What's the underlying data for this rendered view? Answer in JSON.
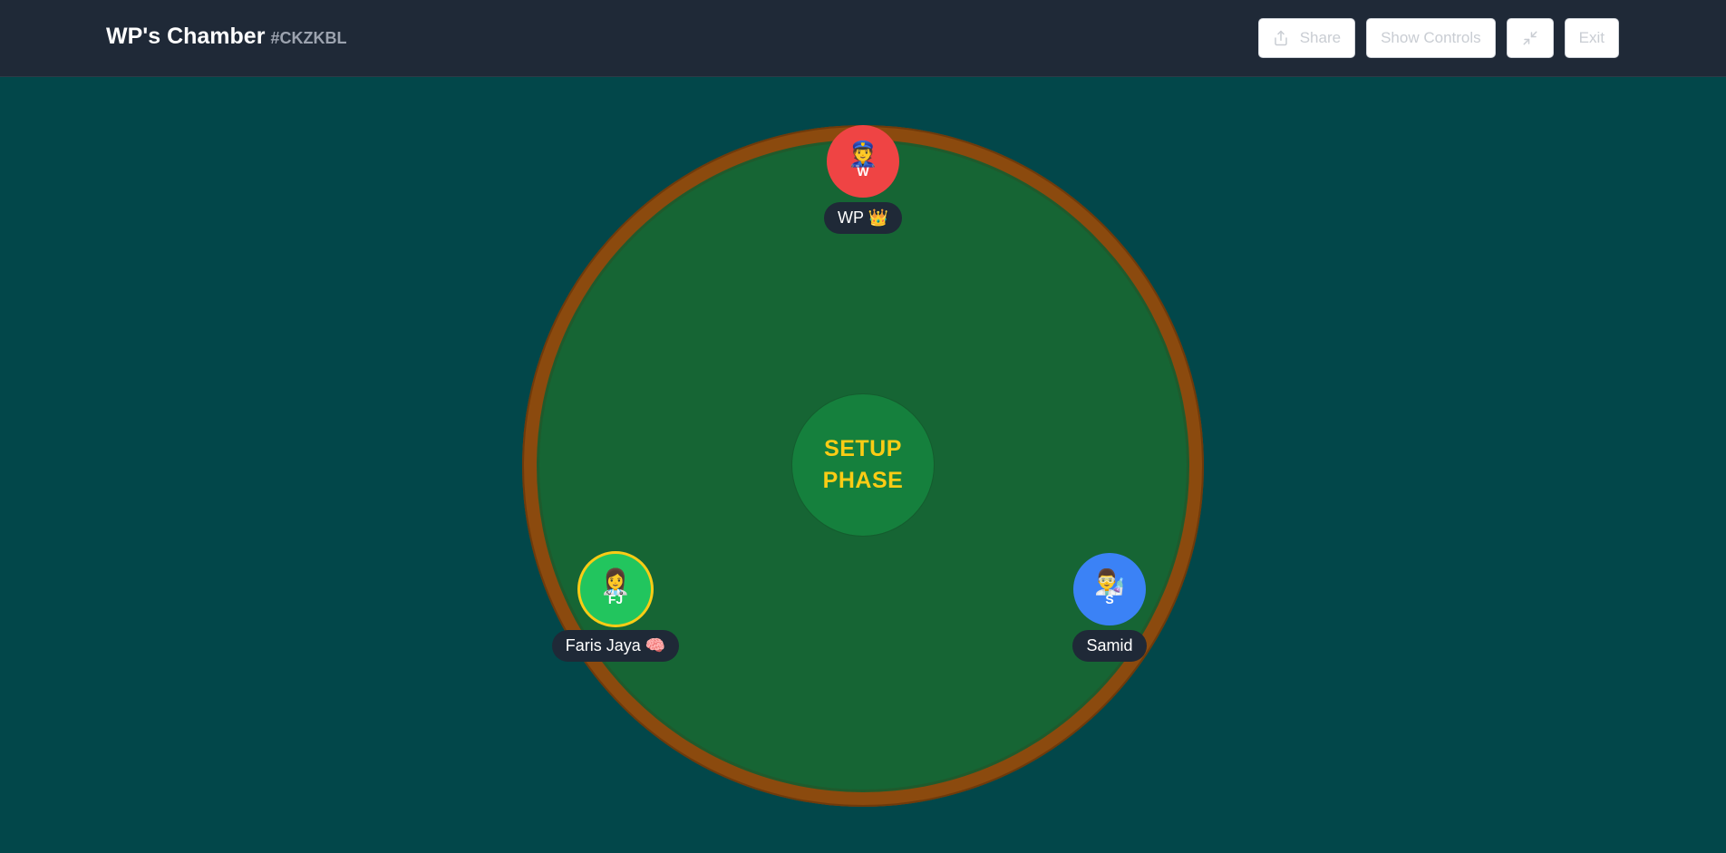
{
  "header": {
    "room_name": "WP's Chamber",
    "room_code": "#CKZKBL"
  },
  "controls": {
    "share_label": "Share",
    "show_controls_label": "Show Controls",
    "exit_label": "Exit",
    "share_icon": "share-icon",
    "minimize_icon": "minimize-icon"
  },
  "table": {
    "phase_line1": "SETUP",
    "phase_line2": "PHASE"
  },
  "players": [
    {
      "name": "WP 👑",
      "initials": "W",
      "emoji": "👮",
      "color": "#ef4444"
    },
    {
      "name": "Faris Jaya 🧠",
      "initials": "FJ",
      "emoji": "👩‍⚕️",
      "color": "#22c55e",
      "ring_color": "#facc15"
    },
    {
      "name": "Samid",
      "initials": "S",
      "emoji": "👨‍🔬",
      "color": "#3b82f6"
    }
  ]
}
